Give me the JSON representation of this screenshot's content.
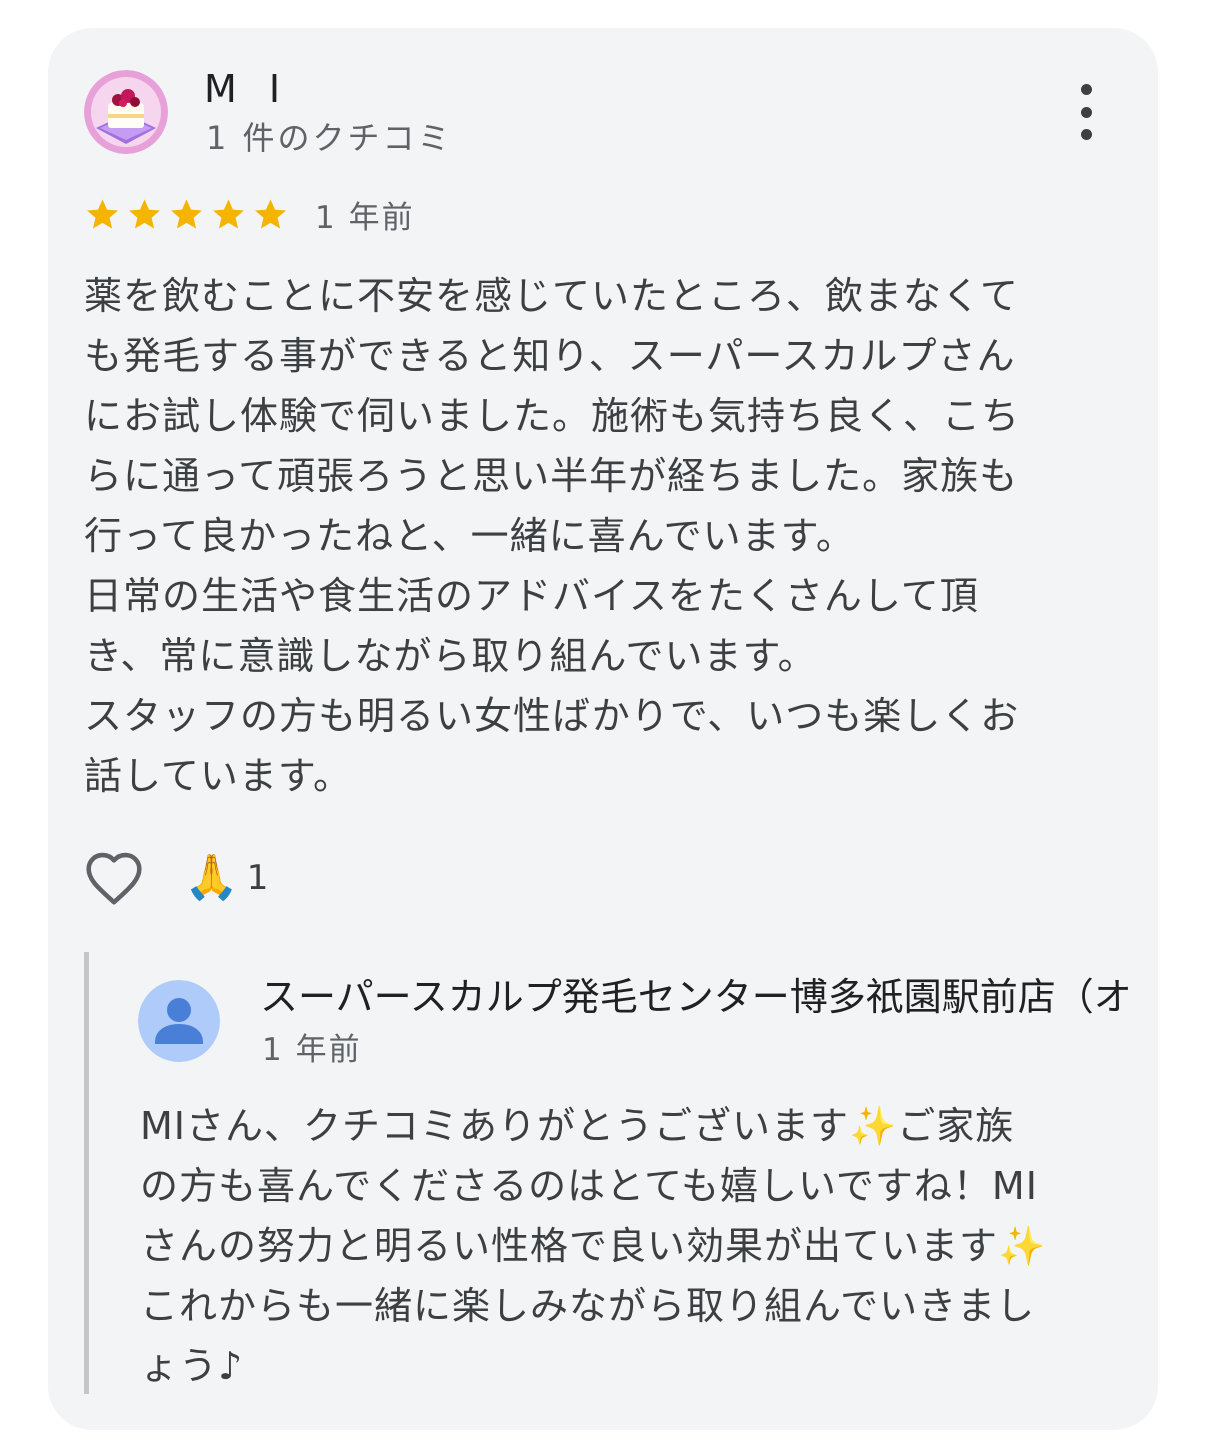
{
  "review": {
    "reviewer_name": "M I",
    "review_count": "1 件のクチコミ",
    "rating": 5,
    "date": "1 年前",
    "text_lines": [
      "薬を飲むことに不安を感じていたところ、飲まなくて",
      "も発毛する事ができると知り、スーパースカルプさん",
      "にお試し体験で伺いました。施術も気持ち良く、こち",
      "らに通って頑張ろうと思い半年が経ちました。家族も",
      "行って良かったねと、一緒に喜んでいます。",
      "日常の生活や食生活のアドバイスをたくさんして頂",
      "き、常に意識しながら取り組んでいます。",
      "スタッフの方も明るい女性ばかりで、いつも楽しくお",
      "話しています。"
    ],
    "reaction_emoji": "🙏",
    "reaction_count": "1"
  },
  "owner_reply": {
    "name": "スーパースカルプ発毛センター博多祇園駅前店（オ",
    "date": "1 年前",
    "text_lines": [
      "MIさん、クチコミありがとうございます✨ご家族",
      "の方も喜んでくださるのはとても嬉しいですね！MI",
      "さんの努力と明るい性格で良い効果が出ています✨",
      "これからも一緒に楽しみながら取り組んでいきまし",
      "ょう♪"
    ]
  },
  "colors": {
    "card_background": "#f3f4f6",
    "star": "#f4b400",
    "avatar_ring": "#e8a0d8",
    "owner_avatar_bg": "#aecbfa",
    "owner_avatar_fg": "#4a7fd8"
  },
  "icons": {
    "more": "more-vert-icon",
    "like": "heart-outline-icon",
    "owner_avatar": "default-person-icon"
  }
}
